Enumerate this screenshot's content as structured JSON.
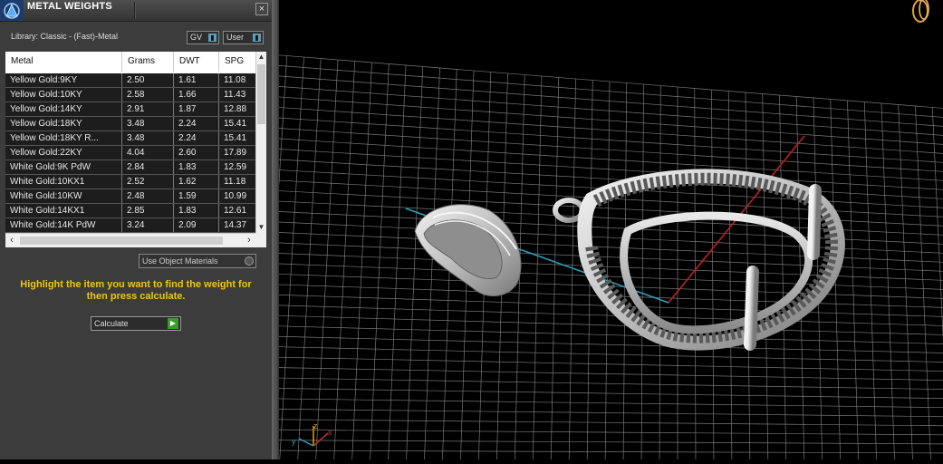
{
  "panel": {
    "title": "METAL WEIGHTS",
    "close_glyph": "×",
    "library_label": "Library: Classic - (Fast)-Metal",
    "gv_dropdown": "GV",
    "user_dropdown": "User",
    "columns": [
      "Metal",
      "Grams",
      "DWT",
      "SPG"
    ],
    "rows": [
      [
        "Yellow Gold:9KY",
        "2.50",
        "1.61",
        "11.08"
      ],
      [
        "Yellow Gold:10KY",
        "2.58",
        "1.66",
        "11.43"
      ],
      [
        "Yellow Gold:14KY",
        "2.91",
        "1.87",
        "12.88"
      ],
      [
        "Yellow Gold:18KY",
        "3.48",
        "2.24",
        "15.41"
      ],
      [
        "Yellow Gold:18KY R...",
        "3.48",
        "2.24",
        "15.41"
      ],
      [
        "Yellow Gold:22KY",
        "4.04",
        "2.60",
        "17.89"
      ],
      [
        "White Gold:9K PdW",
        "2.84",
        "1.83",
        "12.59"
      ],
      [
        "White Gold:10KX1",
        "2.52",
        "1.62",
        "11.18"
      ],
      [
        "White Gold:10KW",
        "2.48",
        "1.59",
        "10.99"
      ],
      [
        "White Gold:14KX1",
        "2.85",
        "1.83",
        "12.61"
      ],
      [
        "White Gold:14K PdW",
        "3.24",
        "2.09",
        "14.37"
      ]
    ],
    "use_object_materials": "Use Object Materials",
    "hint": "Highlight the item you want to find the weight for then press calculate.",
    "calculate_button": "Calculate",
    "colors": {
      "hint": "#f0c419",
      "row_bg": "#1d1d1d",
      "panel_bg": "#3c3c3c",
      "calc_go": "#3a9a2a"
    }
  },
  "viewport": {
    "axis_labels": [
      "x",
      "y",
      "z"
    ],
    "colors": {
      "grid": "#8c8c8c",
      "x_axis": "#c02020",
      "y_axis": "#2aa0c0",
      "model": "#cfcfcf"
    }
  }
}
